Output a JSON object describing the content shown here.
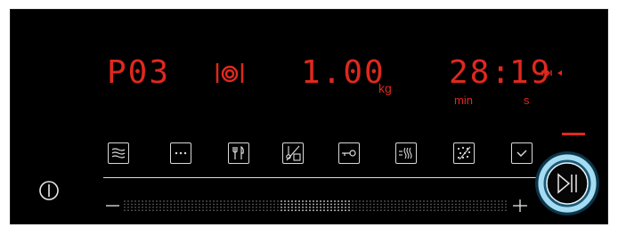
{
  "display": {
    "program": "P03",
    "weight_value": "1.00",
    "weight_unit": "kg",
    "minutes_value": "28:",
    "seconds_value": "19",
    "minutes_unit": "min",
    "seconds_unit": "s"
  },
  "icons": {
    "power": "power-icon",
    "plate": "plate-cutlery-icon",
    "end_time": "end-time-icon",
    "start_pause": "play-pause-icon"
  },
  "function_buttons": [
    "steam-waves-icon",
    "more-dots-icon",
    "cutlery-icon",
    "temperature-weight-icon",
    "key-lock-icon",
    "descaling-icon",
    "drops-icon",
    "check-icon"
  ],
  "slider": {
    "type": "touch-slider"
  },
  "colors": {
    "accent": "#e0281e",
    "ring": "#8fd0ee",
    "background": "#000000"
  }
}
